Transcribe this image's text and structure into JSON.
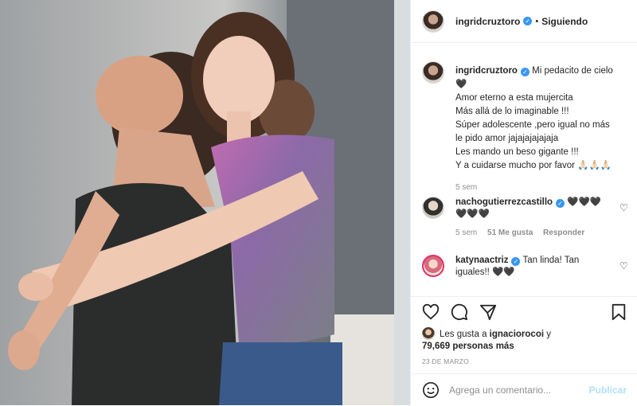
{
  "header": {
    "username": "ingridcruztoro",
    "separator": "•",
    "follow_state": "Siguiendo"
  },
  "caption": {
    "username": "ingridcruztoro",
    "lines": [
      "Mi pedacito de cielo",
      "🖤",
      "Amor eterno a esta mujercita",
      "Más allá de lo imaginable !!!",
      "Súper adolescente ,pero igual no más",
      "le pido amor jajajajajajaja",
      "Les mando un beso gigante !!!",
      "Y a cuidarse mucho por favor 🙏🏻🙏🏻🙏🏻"
    ],
    "time": "5 sem"
  },
  "comments": [
    {
      "username": "nachogutierrezcastillo",
      "text": "🖤🖤🖤 🖤🖤🖤",
      "time": "5 sem",
      "likes": "51 Me gusta",
      "reply": "Responder"
    },
    {
      "username": "katynaactriz",
      "text": "Tan linda! Tan iguales!! 🖤🖤"
    }
  ],
  "likes": {
    "prefix": "Les gusta a",
    "user": "ignaciorocoi",
    "and": "y",
    "count": "79,669 personas más"
  },
  "date": "23 DE MARZO",
  "composer": {
    "placeholder": "Agrega un comentario...",
    "post_label": "Publicar"
  },
  "icons": {
    "like": "heart-icon",
    "comment": "comment-icon",
    "share": "paper-plane-icon",
    "save": "bookmark-icon",
    "emoji": "smiley-icon",
    "verified": "verified-badge-icon"
  },
  "colors": {
    "verified": "#3897f0",
    "post_disabled": "#b2dffc",
    "muted": "#8e8e8e",
    "text": "#262626"
  }
}
